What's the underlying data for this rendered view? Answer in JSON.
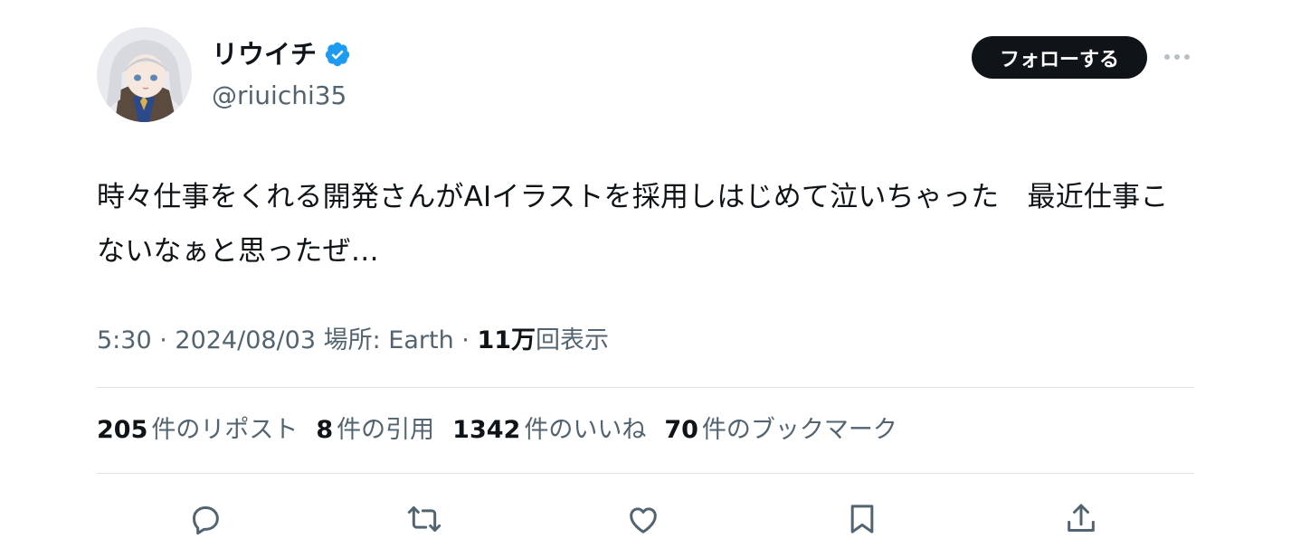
{
  "author": {
    "display_name": "リウイチ",
    "handle": "@riuichi35",
    "verified": true
  },
  "header": {
    "follow_label": "フォローする",
    "more_icon": "more-icon"
  },
  "tweet": {
    "text": "時々仕事をくれる開発さんがAIイラストを採用しはじめて泣いちゃった　最近仕事こないなぁと思ったぜ…"
  },
  "meta": {
    "time": "5:30",
    "sep1": " · ",
    "date": "2024/08/03",
    "location": " 場所: Earth",
    "sep2": " · ",
    "views_count": "11万",
    "views_label": "回表示"
  },
  "stats": [
    {
      "count": "205",
      "label": "件のリポスト"
    },
    {
      "count": "8",
      "label": "件の引用"
    },
    {
      "count": "1342",
      "label": "件のいいね"
    },
    {
      "count": "70",
      "label": "件のブックマーク"
    }
  ],
  "actions": [
    "reply-icon",
    "repost-icon",
    "like-icon",
    "bookmark-icon",
    "share-icon"
  ],
  "colors": {
    "text": "#0f1419",
    "secondary": "#536471",
    "verified": "#1d9bf0",
    "button_bg": "#0f1419"
  }
}
